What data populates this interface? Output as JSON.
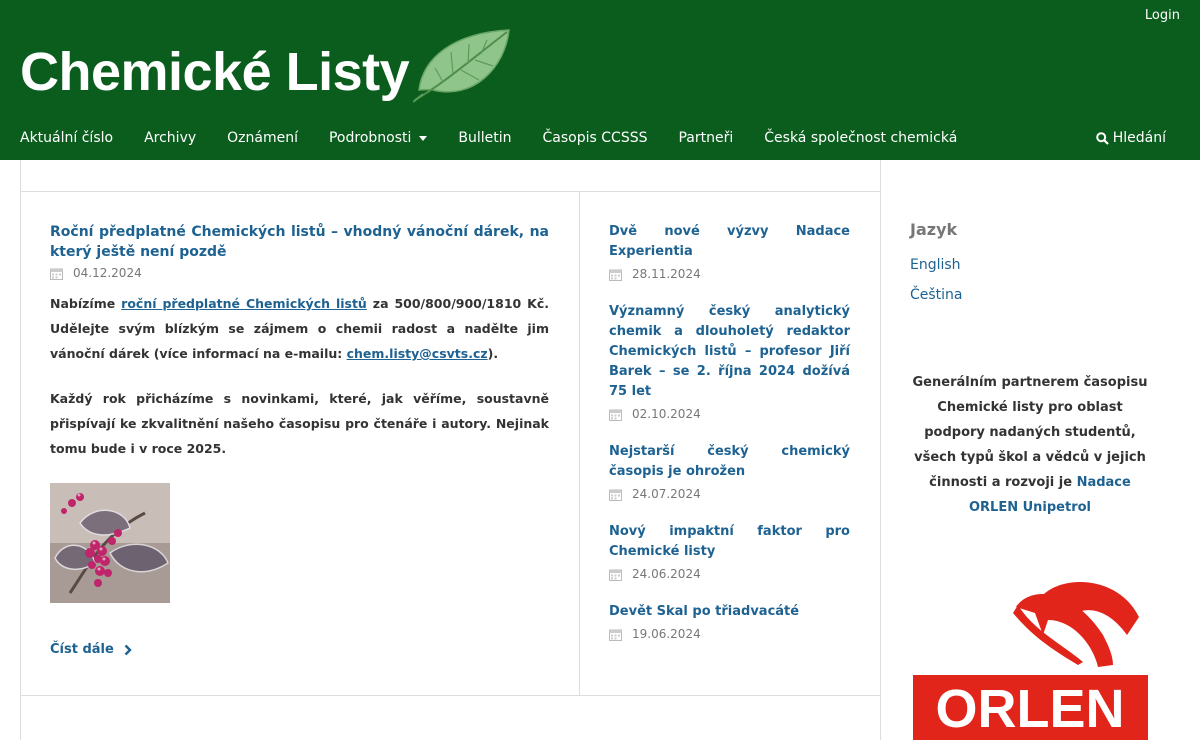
{
  "header": {
    "login": "Login",
    "site_title": "Chemické Listy",
    "nav": [
      {
        "label": "Aktuální číslo"
      },
      {
        "label": "Archivy"
      },
      {
        "label": "Oznámení"
      },
      {
        "label": "Podrobnosti",
        "dropdown": true
      },
      {
        "label": "Bulletin"
      },
      {
        "label": "Časopis CCSSS"
      },
      {
        "label": "Partneři"
      },
      {
        "label": "Česká společnost chemická"
      }
    ],
    "search_label": "Hledání"
  },
  "feature": {
    "title": "Roční předplatné Chemických listů – vhodný vánoční dárek, na který ještě není pozdě",
    "date": "04.12.2024",
    "p1_before": "Nabízíme ",
    "p1_link": "roční předplatné Chemických listů",
    "p1_middle": " za 500/800/900/1810 Kč. Udělejte svým blízkým se zájmem o chemii radost a nadělte jim vánoční dárek (více informací na e-mailu: ",
    "p1_email": "chem.listy@csvts.cz",
    "p1_after": ").",
    "p2": "Každý rok přicházíme s novinkami, které, jak věříme, soustavně přispívají ke zkvalitnění našeho časopisu pro čtenáře i autory. Nejinak tomu bude i v roce 2025.",
    "read_more": "Číst dále"
  },
  "news": [
    {
      "title": "Dvě nové výzvy Nadace Experientia",
      "date": "28.11.2024"
    },
    {
      "title": "Významný český analytický chemik a dlouholetý redaktor Chemických listů – profesor Jiří Barek – se 2. října 2024 dožívá 75 let",
      "date": "02.10.2024"
    },
    {
      "title": "Nejstarší český chemický časopis je ohrožen",
      "date": "24.07.2024"
    },
    {
      "title": "Nový impaktní faktor pro Chemické listy",
      "date": "24.06.2024"
    },
    {
      "title": "Devět Skal po třiadvacáté",
      "date": "19.06.2024"
    }
  ],
  "sidebar": {
    "language_title": "Jazyk",
    "languages": [
      "English",
      "Čeština"
    ],
    "partner_text": "Generálním partnerem časopisu Chemické listy pro oblast podpory nadaných studentů, všech typů škol a vědců v jejich činnosti a rozvoji je ",
    "partner_link": "Nadace ORLEN Unipetrol",
    "orlen_logo_text": "ORLEN"
  },
  "colors": {
    "header_bg": "#0b5d1e",
    "link": "#1e6292",
    "orlen_red": "#e1251b"
  }
}
